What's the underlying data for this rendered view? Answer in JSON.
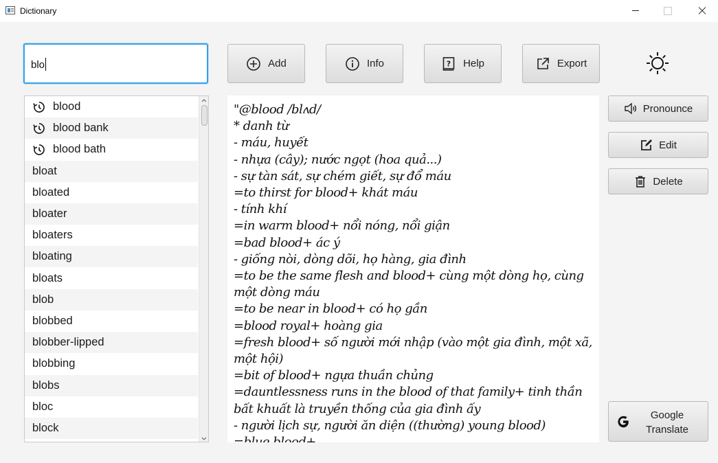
{
  "window": {
    "title": "Dictionary"
  },
  "search": {
    "value": "blo"
  },
  "toolbar": {
    "add_label": "Add",
    "info_label": "Info",
    "help_label": "Help",
    "export_label": "Export",
    "theme_icon": "sun-icon"
  },
  "word_list": {
    "items": [
      {
        "word": "blood",
        "history": true
      },
      {
        "word": "blood bank",
        "history": true
      },
      {
        "word": "blood bath",
        "history": true
      },
      {
        "word": "bloat",
        "history": false
      },
      {
        "word": "bloated",
        "history": false
      },
      {
        "word": "bloater",
        "history": false
      },
      {
        "word": "bloaters",
        "history": false
      },
      {
        "word": "bloating",
        "history": false
      },
      {
        "word": "bloats",
        "history": false
      },
      {
        "word": "blob",
        "history": false
      },
      {
        "word": "blobbed",
        "history": false
      },
      {
        "word": "blobber-lipped",
        "history": false
      },
      {
        "word": "blobbing",
        "history": false
      },
      {
        "word": "blobs",
        "history": false
      },
      {
        "word": "bloc",
        "history": false
      },
      {
        "word": "block",
        "history": false
      }
    ]
  },
  "definition": {
    "text": "\"@blood /blʌd/\n* danh từ\n- máu, huyết\n- nhựa (cây); nước ngọt (hoa quả...)\n- sự tàn sát, sự chém giết, sự đổ máu\n=to thirst for blood+ khát máu\n- tính khí\n=in warm blood+ nổi nóng, nổi giận\n=bad blood+ ác ý\n- giống nòi, dòng dõi, họ hàng, gia đình\n=to be the same flesh and blood+ cùng một dòng họ, cùng một dòng máu\n=to be near in blood+ có họ gần\n=blood royal+ hoàng gia\n=fresh blood+ số người mới nhập (vào một gia đình, một xã, một hội)\n=bit of blood+ ngựa thuần chủng\n=dauntlessness runs in the blood of that family+ tinh thần bất khuất là truyền thống của gia đình ấy\n- người lịch sự, người ăn diện ((thường) young blood)\n=blue blood+"
  },
  "side": {
    "pronounce_label": "Pronounce",
    "edit_label": "Edit",
    "delete_label": "Delete",
    "google_label": "Google\nTranslate"
  }
}
